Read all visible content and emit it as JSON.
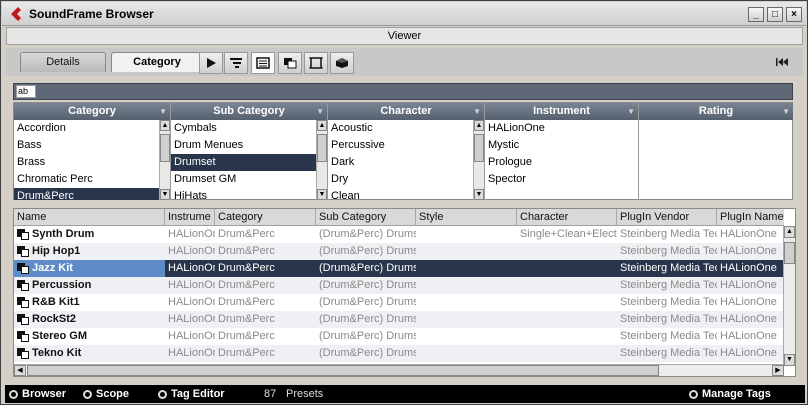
{
  "window": {
    "title": "SoundFrame Browser",
    "buttons": [
      "_",
      "□",
      "×"
    ]
  },
  "viewer_label": "Viewer",
  "tabs": [
    {
      "label": "Details",
      "active": false
    },
    {
      "label": "Category",
      "active": true
    }
  ],
  "toolbar_icons": [
    "play-icon",
    "sort-levels-icon",
    "list-view-icon",
    "window-mode-icon",
    "film-frame-icon",
    "cube-icon"
  ],
  "search_field": {
    "value": "ab"
  },
  "filter_columns": [
    {
      "header": "Category",
      "items": [
        "Accordion",
        "Bass",
        "Brass",
        "Chromatic Perc",
        "Drum&Perc"
      ],
      "selected": 4
    },
    {
      "header": "Sub Category",
      "items": [
        "Cymbals",
        "Drum Menues",
        "Drumset",
        "Drumset GM",
        "HiHats"
      ],
      "selected": 2
    },
    {
      "header": "Character",
      "items": [
        "Acoustic",
        "Percussive",
        "Dark",
        "Dry",
        "Clean"
      ],
      "selected": -1
    },
    {
      "header": "Instrument",
      "items": [
        "HALionOne",
        "Mystic",
        "Prologue",
        "Spector"
      ],
      "selected": -1
    },
    {
      "header": "Rating",
      "items": [],
      "selected": -1
    }
  ],
  "results": {
    "columns": [
      "Name",
      "Instrume",
      "Category",
      "Sub Category",
      "Style",
      "Character",
      "PlugIn Vendor",
      "PlugIn Name"
    ],
    "rows": [
      {
        "name": "Synth Drum",
        "instrument": "HALionOne",
        "category": "Drum&Perc",
        "sub_category": "(Drum&Perc) Drumset",
        "style": "",
        "character": "Single+Clean+Electric",
        "vendor": "Steinberg Media Tech",
        "plugin": "HALionOne",
        "selected": false
      },
      {
        "name": "Hip Hop1",
        "instrument": "HALionOne",
        "category": "Drum&Perc",
        "sub_category": "(Drum&Perc) Drumset",
        "style": "",
        "character": "",
        "vendor": "Steinberg Media Tech",
        "plugin": "HALionOne",
        "selected": false
      },
      {
        "name": "Jazz Kit",
        "instrument": "HALionOne",
        "category": "Drum&Perc",
        "sub_category": "(Drum&Perc) Drumset",
        "style": "",
        "character": "",
        "vendor": "Steinberg Media Tech",
        "plugin": "HALionOne",
        "selected": true
      },
      {
        "name": "Percussion",
        "instrument": "HALionOne",
        "category": "Drum&Perc",
        "sub_category": "(Drum&Perc) Drumset",
        "style": "",
        "character": "",
        "vendor": "Steinberg Media Tech",
        "plugin": "HALionOne",
        "selected": false
      },
      {
        "name": "R&B Kit1",
        "instrument": "HALionOne",
        "category": "Drum&Perc",
        "sub_category": "(Drum&Perc) Drumset",
        "style": "",
        "character": "",
        "vendor": "Steinberg Media Tech",
        "plugin": "HALionOne",
        "selected": false
      },
      {
        "name": "RockSt2",
        "instrument": "HALionOne",
        "category": "Drum&Perc",
        "sub_category": "(Drum&Perc) Drumset",
        "style": "",
        "character": "",
        "vendor": "Steinberg Media Tech",
        "plugin": "HALionOne",
        "selected": false
      },
      {
        "name": "Stereo GM",
        "instrument": "HALionOne",
        "category": "Drum&Perc",
        "sub_category": "(Drum&Perc) Drumset",
        "style": "",
        "character": "",
        "vendor": "Steinberg Media Tech",
        "plugin": "HALionOne",
        "selected": false
      },
      {
        "name": "Tekno Kit",
        "instrument": "HALionOne",
        "category": "Drum&Perc",
        "sub_category": "(Drum&Perc) Drumset",
        "style": "",
        "character": "",
        "vendor": "Steinberg Media Tech",
        "plugin": "HALionOne",
        "selected": false
      }
    ]
  },
  "statusbar": {
    "browser_label": "Browser",
    "scope_label": "Scope",
    "tag_editor_label": "Tag Editor",
    "preset_count": "87",
    "preset_label": "Presets",
    "manage_tags_label": "Manage Tags"
  },
  "colors": {
    "selection": "#28354a",
    "selection_name": "#5f8cc8",
    "header": "#5f6877"
  }
}
